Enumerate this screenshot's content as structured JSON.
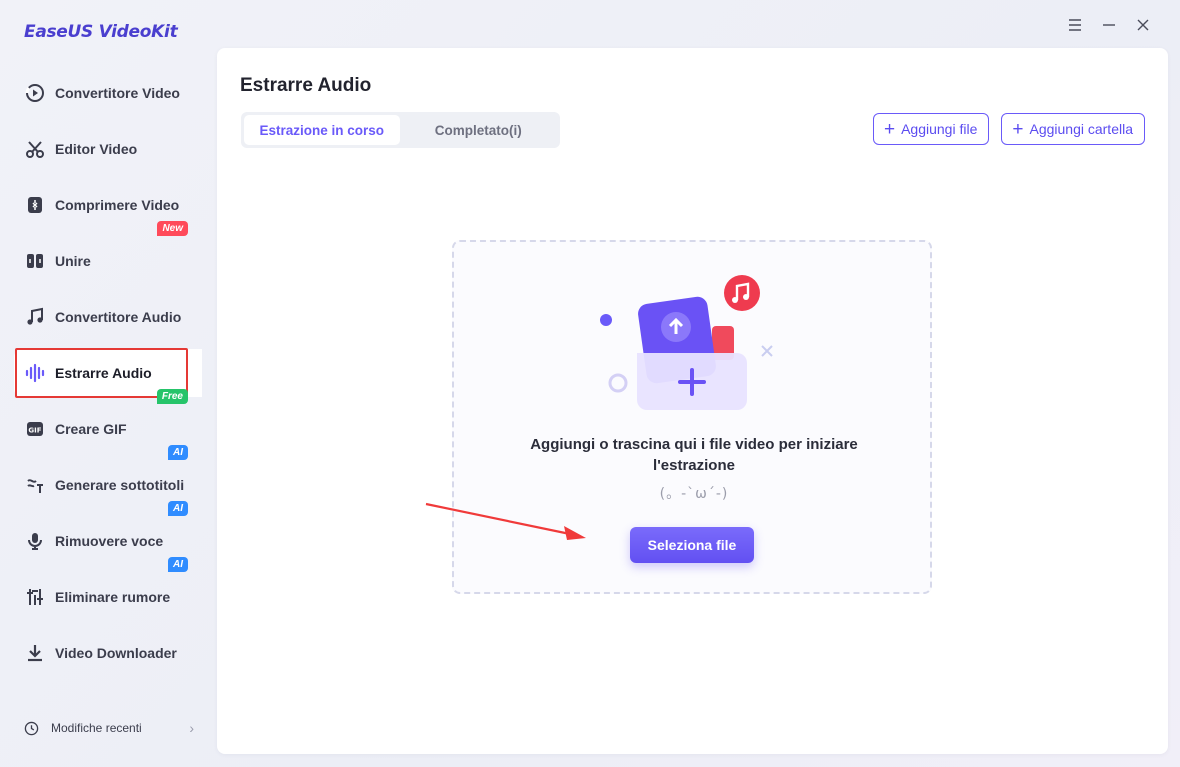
{
  "app": {
    "name": "EaseUS VideoKit"
  },
  "window_controls": [
    {
      "icon": "menu-icon"
    },
    {
      "icon": "minimize-icon"
    },
    {
      "icon": "close-icon"
    }
  ],
  "sidebar": {
    "items": [
      {
        "label": "Convertitore Video",
        "icon": "video-convert-icon"
      },
      {
        "label": "Editor Video",
        "icon": "scissors-icon"
      },
      {
        "label": "Comprimere Video",
        "icon": "compress-icon"
      },
      {
        "label": "Unire",
        "icon": "merge-icon",
        "badge": "New"
      },
      {
        "label": "Convertitore Audio",
        "icon": "music-note-icon"
      },
      {
        "label": "Estrarre Audio",
        "icon": "audio-wave-icon",
        "active": true
      },
      {
        "label": "Creare GIF",
        "icon": "gif-icon",
        "badge": "Free"
      },
      {
        "label": "Generare sottotitoli",
        "icon": "subtitle-icon",
        "badge": "AI"
      },
      {
        "label": "Rimuovere voce",
        "icon": "microphone-icon",
        "badge": "AI"
      },
      {
        "label": "Eliminare rumore",
        "icon": "equalizer-icon",
        "badge": "AI"
      },
      {
        "label": "Video Downloader",
        "icon": "download-icon"
      }
    ],
    "recent": {
      "label": "Modifiche recenti",
      "icon": "clock-icon"
    }
  },
  "main": {
    "title": "Estrarre Audio",
    "tabs": [
      {
        "label": "Estrazione in corso",
        "active": true
      },
      {
        "label": "Completato(i)",
        "active": false
      }
    ],
    "actions": {
      "add_file": "Aggiungi file",
      "add_folder": "Aggiungi cartella"
    },
    "dropzone": {
      "message": "Aggiungi o trascina qui i file video per iniziare l'estrazione",
      "emoticon": "(。-`ω´-)",
      "button": "Seleziona file"
    }
  },
  "colors": {
    "accent": "#6a5af9",
    "brand": "#4a3fcf",
    "highlight_box": "#e53935",
    "badge_new": "#ff4a5a",
    "badge_free": "#26c46a",
    "badge_ai": "#2f8cff"
  }
}
